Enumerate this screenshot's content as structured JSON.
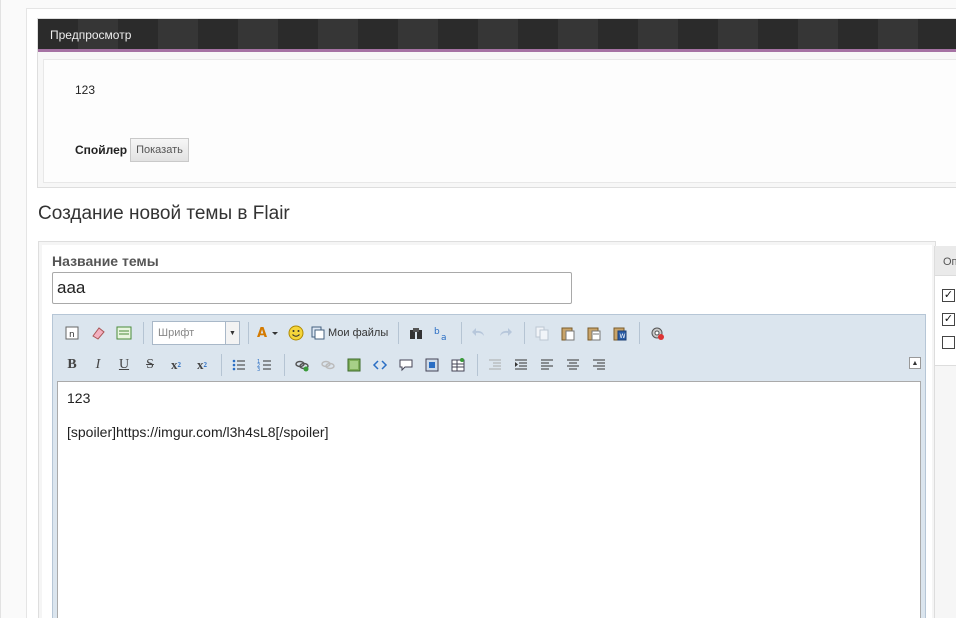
{
  "preview": {
    "header_title": "Предпросмотр",
    "body_text": "123",
    "spoiler_label": "Спойлер",
    "spoiler_button": "Показать"
  },
  "page_title": "Создание новой темы в Flair",
  "form": {
    "title_label": "Название темы",
    "title_value": "aaa"
  },
  "editor": {
    "font_select": "Шрифт",
    "my_files_label": "Мои файлы",
    "toolbar_row1": [
      "remove-format-icon",
      "eraser-icon",
      "source-icon",
      "font-select",
      "text-color-icon",
      "smiley-icon",
      "my-files-button",
      "insert-media-icon",
      "translate-icon",
      "undo-icon",
      "redo-icon",
      "copy-icon",
      "paste-icon",
      "paste-text-icon",
      "paste-word-icon",
      "settings-icon"
    ],
    "toolbar_row2": [
      "bold",
      "italic",
      "underline",
      "strike",
      "subscript",
      "superscript",
      "bullet-list",
      "numbered-list",
      "link",
      "unlink",
      "image",
      "code",
      "quote",
      "media",
      "table",
      "outdent",
      "indent",
      "align-left",
      "align-center",
      "align-right"
    ],
    "content_lines": [
      "123",
      "",
      "[spoiler]https://imgur.com/l3h4sL8[/spoiler]"
    ]
  },
  "options": {
    "header": "Оп",
    "checkboxes": [
      true,
      true,
      false
    ]
  }
}
